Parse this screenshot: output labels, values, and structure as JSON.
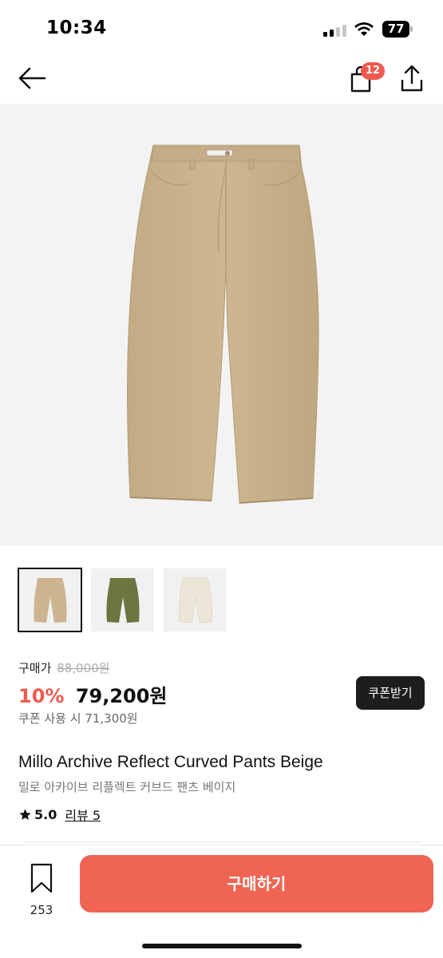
{
  "status_bar": {
    "time": "10:34",
    "battery": "77",
    "icons": [
      "signal-icon",
      "wifi-icon",
      "battery-icon"
    ]
  },
  "nav": {
    "back_icon": "arrow-left-icon",
    "cart_icon": "shopping-bag-icon",
    "cart_badge": "12",
    "share_icon": "share-icon"
  },
  "product": {
    "images": [
      {
        "color_name": "beige",
        "color": "#cbb48f"
      },
      {
        "color_name": "olive",
        "color": "#6e7440"
      },
      {
        "color_name": "cream",
        "color": "#ece6d9"
      }
    ],
    "selected_image_index": 0,
    "price_label": "구매가",
    "original_price": "88,000원",
    "discount": "10%",
    "sale_price": "79,200원",
    "coupon_price": "쿠폰 사용 시 71,300원",
    "coupon_button": "쿠폰받기",
    "name": "Millo Archive Reflect Curved Pants Beige",
    "name_ko": "밀로 아카이브 리플렉트 커브드 팬츠 베이지",
    "rating": "5.0",
    "review_label": "리뷰 5"
  },
  "bottom_bar": {
    "wish_icon": "bookmark-icon",
    "wish_count": "253",
    "buy_button": "구매하기"
  },
  "colors": {
    "accent": "#ef5a4f",
    "buy_button": "#ef6453",
    "coupon_button": "#1d1d1f",
    "image_background": "#f3f3f3"
  }
}
